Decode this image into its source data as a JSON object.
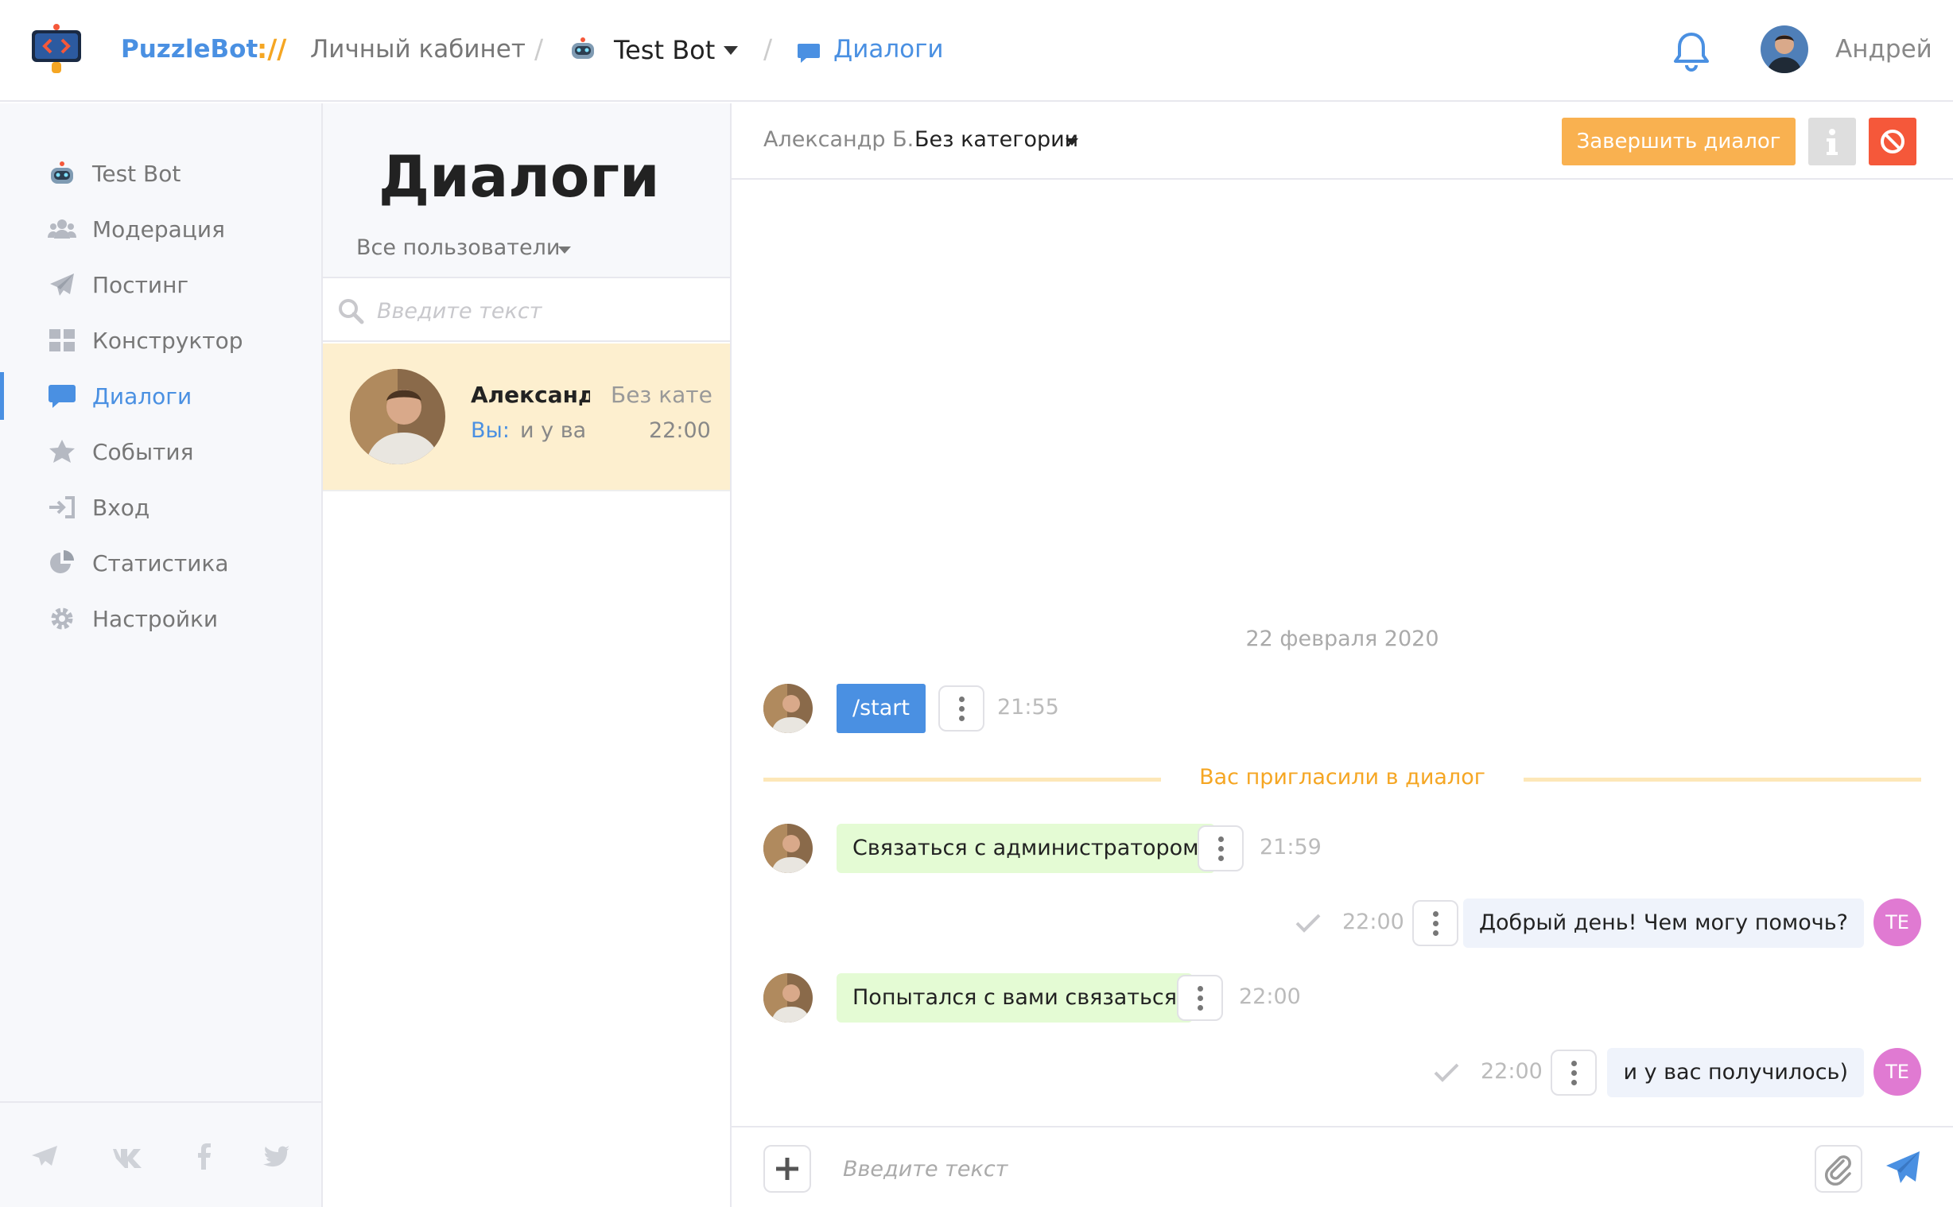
{
  "header": {
    "brand": "PuzzleBot",
    "brand_sep": "://",
    "cabinet": "Личный кабинет",
    "slash": "/",
    "bot_name": "Test Bot",
    "crumb_dialogs": "Диалоги",
    "user_name": "Андрей"
  },
  "sidebar": {
    "items": [
      {
        "label": "Test Bot",
        "icon": "robot-icon"
      },
      {
        "label": "Модерация",
        "icon": "users-icon"
      },
      {
        "label": "Постинг",
        "icon": "paper-plane-icon"
      },
      {
        "label": "Конструктор",
        "icon": "grid-icon"
      },
      {
        "label": "Диалоги",
        "icon": "chat-icon",
        "active": true
      },
      {
        "label": "События",
        "icon": "star-icon"
      },
      {
        "label": "Вход",
        "icon": "sign-in-icon"
      },
      {
        "label": "Статистика",
        "icon": "pie-chart-icon"
      },
      {
        "label": "Настройки",
        "icon": "gear-icon"
      }
    ],
    "social": [
      "telegram-icon",
      "vk-icon",
      "facebook-icon",
      "twitter-icon"
    ]
  },
  "dialog_list": {
    "title": "Диалоги",
    "filter": "Все пользователи",
    "search_placeholder": "Введите текст",
    "items": [
      {
        "name": "Александр Б.",
        "category": "Без категории",
        "you": "Вы:",
        "last_message": "и у вас получилось)",
        "time": "22:00"
      }
    ]
  },
  "chat": {
    "user": "Александр Б.",
    "category": "Без категории",
    "finish_label": "Завершить диалог",
    "date": "22 февраля 2020",
    "invite_text": "Вас пригласили в диалог",
    "messages": [
      {
        "text": "/start",
        "time": "21:55"
      },
      {
        "text": "Связаться с администратором",
        "time": "21:59"
      },
      {
        "text": "Добрый день! Чем могу помочь?",
        "time": "22:00",
        "initials": "TE"
      },
      {
        "text": "Попытался с вами связаться",
        "time": "22:00"
      },
      {
        "text": "и у вас получилось)",
        "time": "22:00",
        "initials": "TE"
      }
    ],
    "composer_placeholder": "Введите текст"
  },
  "colors": {
    "accent": "#4a90e2",
    "orange": "#f9b150",
    "danger": "#f5583a",
    "incoming": "#e4fbd4",
    "outgoing": "#eff3fb",
    "selected": "#fdefcf",
    "operator_avatar": "#e07ad2"
  }
}
